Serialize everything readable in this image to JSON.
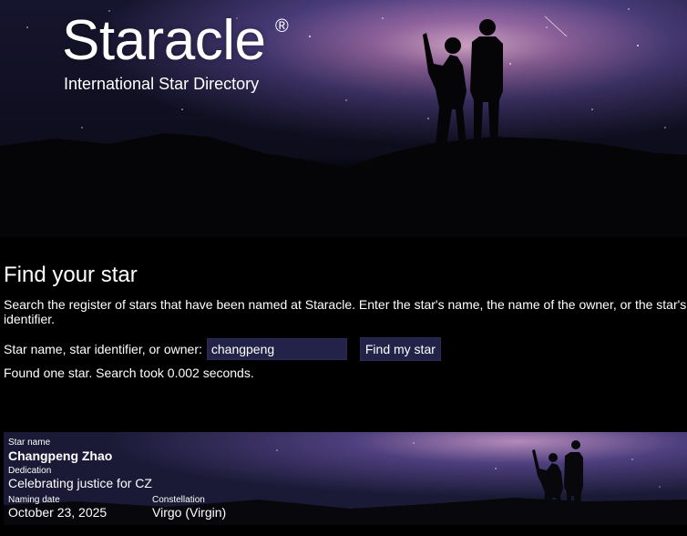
{
  "brand": {
    "title": "Staracle",
    "registered": "®",
    "subtitle": "International Star Directory"
  },
  "find": {
    "heading": "Find your star",
    "description": "Search the register of stars that have been named at Staracle. Enter the star's name, the name of the owner, or the star's identifier.",
    "search_label": "Star name, star identifier, or owner:",
    "search_value": "changpeng",
    "button_label": "Find my star",
    "result_message": "Found one star. Search took 0.002 seconds."
  },
  "result": {
    "star_name_label": "Star name",
    "star_name": "Changpeng Zhao",
    "dedication_label": "Dedication",
    "dedication": "Celebrating justice for CZ",
    "naming_date_label": "Naming date",
    "naming_date": "October 23, 2025",
    "constellation_label": "Constellation",
    "constellation": "Virgo (Virgin)"
  },
  "colors": {
    "background": "#000000",
    "input_bg": "#23234a",
    "sky_purple": "#4a3a7a"
  }
}
